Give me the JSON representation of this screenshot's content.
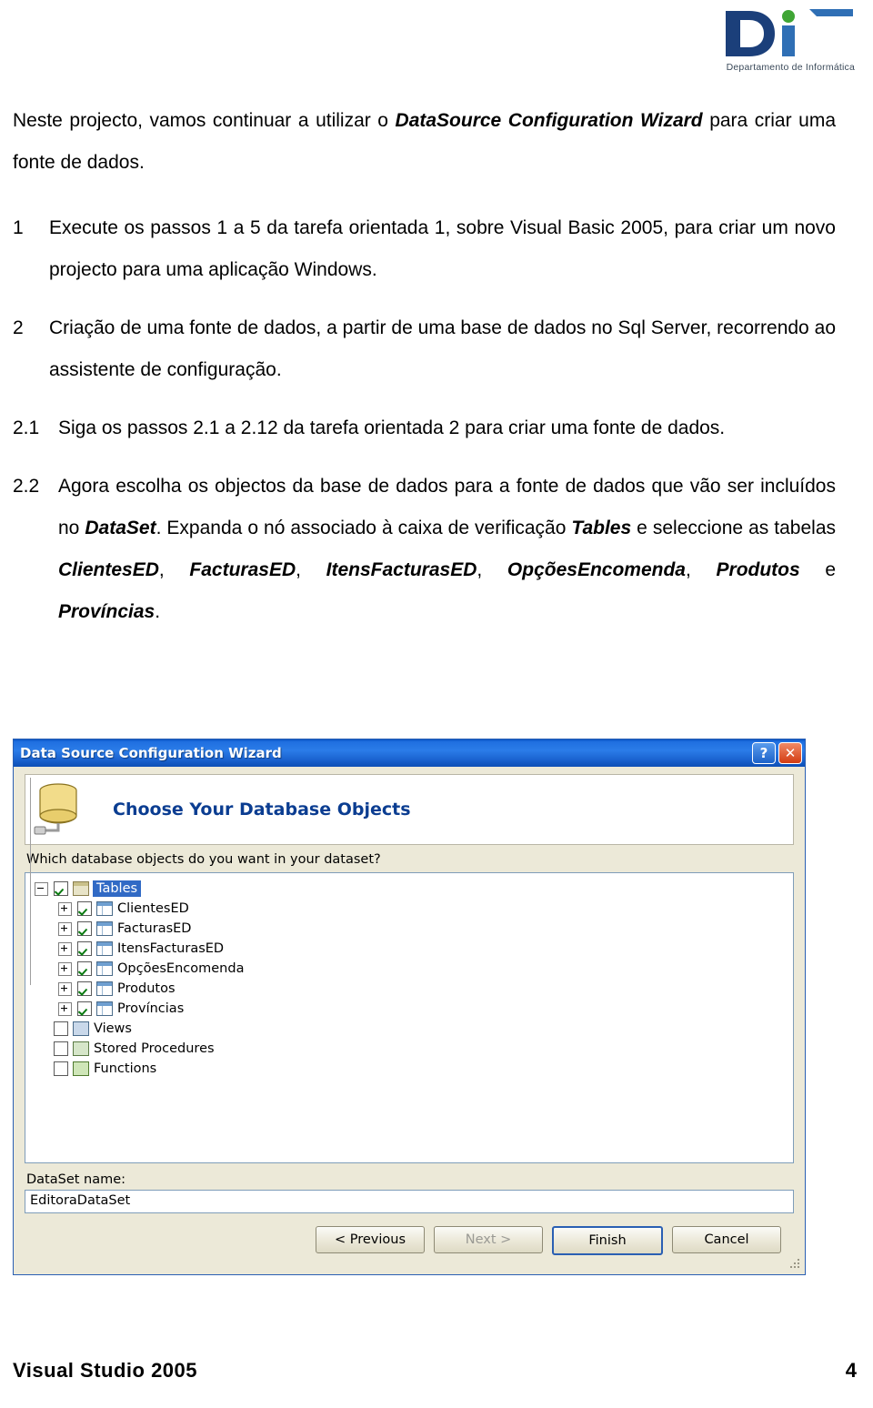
{
  "logo": {
    "letters": "di",
    "caption": "Departamento de Informática",
    "colors": {
      "dark_blue": "#1b3f7a",
      "mid_blue": "#2f6fb5",
      "green": "#3fa535"
    }
  },
  "content": {
    "intro_1": "Neste projecto, vamos continuar a utilizar o ",
    "intro_em": "DataSource Configuration Wizard",
    "intro_2": " para criar uma fonte de dados.",
    "items": [
      {
        "number": "1",
        "text": "Execute os passos 1 a 5 da tarefa orientada 1, sobre Visual Basic 2005, para criar um novo projecto para uma aplicação Windows."
      },
      {
        "number": "2",
        "text": "Criação de uma fonte de dados, a partir de uma base de dados no Sql Server, recorrendo ao assistente de configuração."
      },
      {
        "number": "2.1",
        "text": "Siga os passos 2.1 a 2.12 da tarefa orientada 2 para criar uma fonte de dados."
      }
    ],
    "item_22": {
      "number": "2.2",
      "part1": "Agora escolha os objectos da base de dados para a fonte de dados que vão ser incluídos no ",
      "em1": "DataSet",
      "part2": ". Expanda o nó associado à caixa de verificação ",
      "em2": "Tables",
      "part3": " e seleccione as tabelas ",
      "em3": "ClientesED",
      "part4": ", ",
      "em4": "FacturasED",
      "part5": ", ",
      "em5": "ItensFacturasED",
      "part6": ", ",
      "em6": "OpçõesEncomenda",
      "part7": ", ",
      "em7": "Produtos",
      "part8": " e ",
      "em8": "Províncias",
      "part9": "."
    }
  },
  "dialog": {
    "title": "Data Source Configuration Wizard",
    "help_button": "?",
    "close_button": "✕",
    "banner_title": "Choose Your Database Objects",
    "question": "Which database objects do you want in your dataset?",
    "tree": [
      {
        "label": "Tables",
        "level": 1,
        "expander": "minus",
        "checked": true,
        "icon": "tables-folder-icon",
        "selected": true
      },
      {
        "label": "ClientesED",
        "level": 2,
        "expander": "plus",
        "checked": true,
        "icon": "table-grid-icon",
        "selected": false
      },
      {
        "label": "FacturasED",
        "level": 2,
        "expander": "plus",
        "checked": true,
        "icon": "table-grid-icon",
        "selected": false
      },
      {
        "label": "ItensFacturasED",
        "level": 2,
        "expander": "plus",
        "checked": true,
        "icon": "table-grid-icon",
        "selected": false
      },
      {
        "label": "OpçõesEncomenda",
        "level": 2,
        "expander": "plus",
        "checked": true,
        "icon": "table-grid-icon",
        "selected": false
      },
      {
        "label": "Produtos",
        "level": 2,
        "expander": "plus",
        "checked": true,
        "icon": "table-grid-icon",
        "selected": false
      },
      {
        "label": "Províncias",
        "level": 2,
        "expander": "plus",
        "checked": true,
        "icon": "table-grid-icon",
        "selected": false
      },
      {
        "label": "Views",
        "level": 1,
        "expander": "none",
        "checked": false,
        "icon": "views-icon",
        "selected": false
      },
      {
        "label": "Stored Procedures",
        "level": 1,
        "expander": "none",
        "checked": false,
        "icon": "stored-procedures-icon",
        "selected": false
      },
      {
        "label": "Functions",
        "level": 1,
        "expander": "none",
        "checked": false,
        "icon": "functions-icon",
        "selected": false
      }
    ],
    "dataset_label": "DataSet name:",
    "dataset_value": "EditoraDataSet",
    "buttons": {
      "previous": "< Previous",
      "next": "Next >",
      "finish": "Finish",
      "cancel": "Cancel"
    }
  },
  "footer": {
    "title": "Visual Studio 2005",
    "page": "4"
  }
}
